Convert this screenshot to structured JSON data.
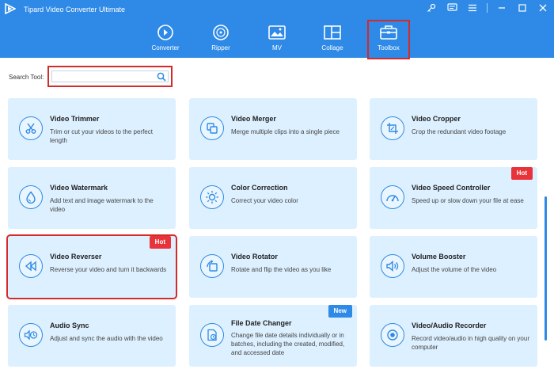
{
  "app": {
    "title": "Tipard Video Converter Ultimate"
  },
  "nav": [
    {
      "label": "Converter",
      "icon": "converter-icon"
    },
    {
      "label": "Ripper",
      "icon": "ripper-icon"
    },
    {
      "label": "MV",
      "icon": "mv-icon"
    },
    {
      "label": "Collage",
      "icon": "collage-icon"
    },
    {
      "label": "Toolbox",
      "icon": "toolbox-icon",
      "active": true
    }
  ],
  "search": {
    "label": "Search Tool:",
    "placeholder": ""
  },
  "tools": [
    {
      "name": "Video Trimmer",
      "desc": "Trim or cut your videos to the perfect length",
      "icon": "scissors-icon"
    },
    {
      "name": "Video Merger",
      "desc": "Merge multiple clips into a single piece",
      "icon": "merge-icon"
    },
    {
      "name": "Video Cropper",
      "desc": "Crop the redundant video footage",
      "icon": "crop-icon"
    },
    {
      "name": "Video Watermark",
      "desc": "Add text and image watermark to the video",
      "icon": "droplet-icon"
    },
    {
      "name": "Color Correction",
      "desc": "Correct your video color",
      "icon": "sun-icon"
    },
    {
      "name": "Video Speed Controller",
      "desc": "Speed up or slow down your file at ease",
      "icon": "speedometer-icon",
      "badge": "Hot"
    },
    {
      "name": "Video Reverser",
      "desc": "Reverse your video and turn it backwards",
      "icon": "rewind-icon",
      "badge": "Hot"
    },
    {
      "name": "Video Rotator",
      "desc": "Rotate and flip the video as you like",
      "icon": "rotate-icon"
    },
    {
      "name": "Volume Booster",
      "desc": "Adjust the volume of the video",
      "icon": "volume-icon"
    },
    {
      "name": "Audio Sync",
      "desc": "Adjust and sync the audio with the video",
      "icon": "audio-sync-icon"
    },
    {
      "name": "File Date Changer",
      "desc": "Change file date details individually or in batches, including the created, modified, and accessed date",
      "icon": "file-date-icon",
      "badge": "New"
    },
    {
      "name": "Video/Audio Recorder",
      "desc": "Record video/audio in high quality on your computer",
      "icon": "record-icon"
    }
  ],
  "colors": {
    "accent": "#2e8ae6",
    "card_bg": "#ddf0ff",
    "hot": "#e8333a",
    "highlight": "#d42a2a"
  }
}
